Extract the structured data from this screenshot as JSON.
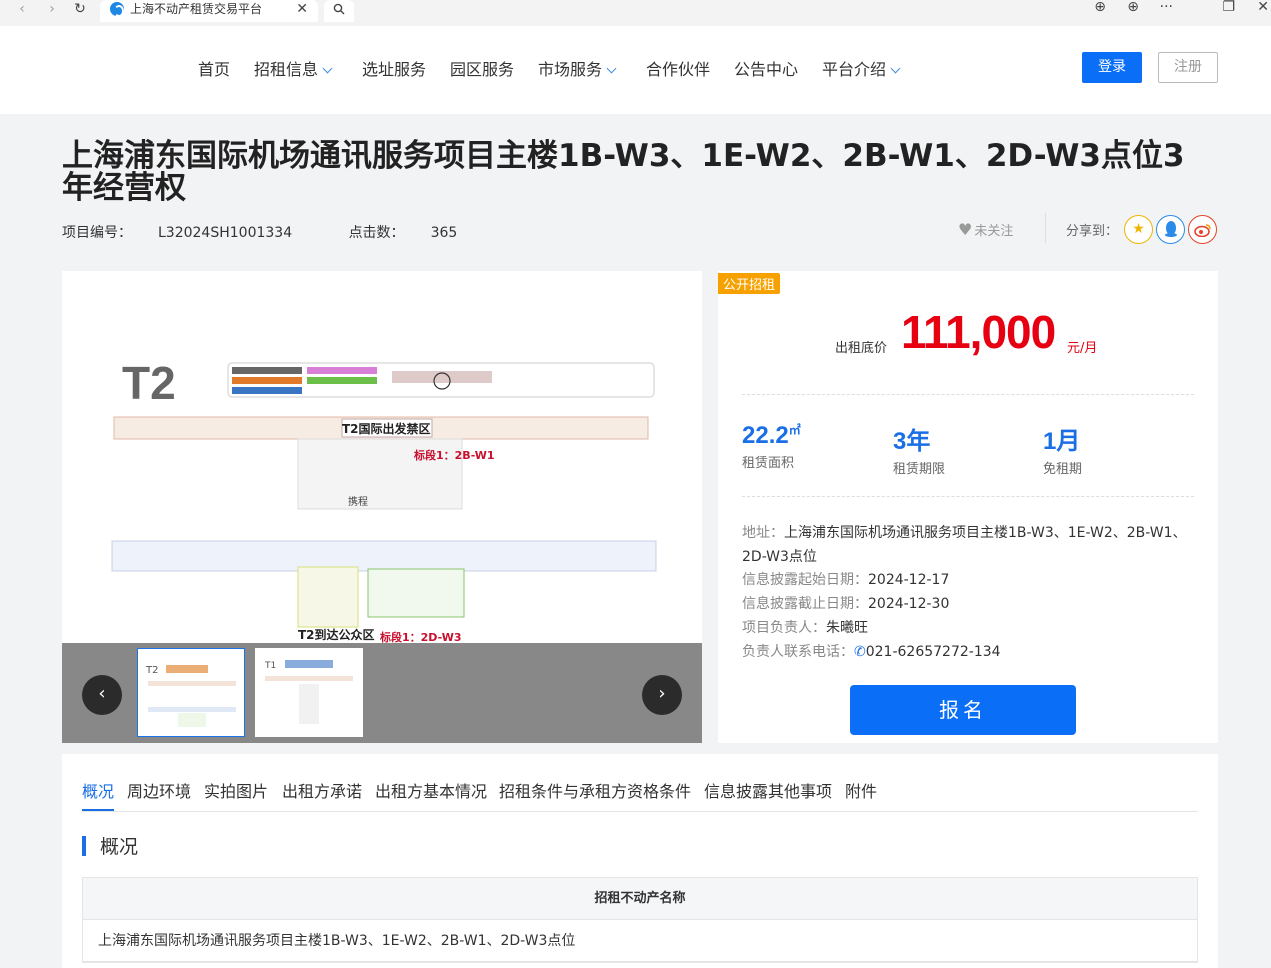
{
  "browser": {
    "tab_title": "上海不动产租赁交易平台"
  },
  "header": {
    "nav": [
      {
        "label": "首页",
        "dropdown": false
      },
      {
        "label": "招租信息",
        "dropdown": true
      },
      {
        "label": "选址服务",
        "dropdown": false
      },
      {
        "label": "园区服务",
        "dropdown": false
      },
      {
        "label": "市场服务",
        "dropdown": true
      },
      {
        "label": "合作伙伴",
        "dropdown": false
      },
      {
        "label": "公告中心",
        "dropdown": false
      },
      {
        "label": "平台介绍",
        "dropdown": true
      }
    ],
    "login_label": "登录",
    "register_label": "注册"
  },
  "project": {
    "title": "上海浦东国际机场通讯服务项目主楼1B-W3、1E-W2、2B-W1、2D-W3点位3年经营权",
    "code_label": "项目编号：",
    "code": "L32024SH1001334",
    "clicks_label": "点击数：",
    "clicks": "365",
    "follow_label": "未关注",
    "share_label": "分享到："
  },
  "gallery": {
    "map_labels": {
      "terminal": "T2",
      "departure": "T2国际出发禁区",
      "arrival": "T2到达公众区",
      "lot1_w1": "标段1：2B-W1",
      "lot1_w3": "标段1：2D-W3",
      "ctrip": "携程"
    },
    "thumb_labels": [
      "T2",
      "T1"
    ]
  },
  "panel": {
    "badge": "公开招租",
    "price_label": "出租底价",
    "price": "111,000",
    "price_unit": "元/月",
    "stats": [
      {
        "value": "22.2",
        "unit": "㎡",
        "label": "租赁面积"
      },
      {
        "value": "3年",
        "unit": "",
        "label": "租赁期限"
      },
      {
        "value": "1月",
        "unit": "",
        "label": "免租期"
      }
    ],
    "address_label": "地址：",
    "address": "上海浦东国际机场通讯服务项目主楼1B-W3、1E-W2、2B-W1、2D-W3点位",
    "start_label": "信息披露起始日期：",
    "start_date": "2024-12-17",
    "end_label": "信息披露截止日期：",
    "end_date": "2024-12-30",
    "manager_label": "项目负责人：",
    "manager": "朱曦旺",
    "phone_label": "负责人联系电话：",
    "phone": "021-62657272-134",
    "apply_label": "报名"
  },
  "content": {
    "tabs": [
      "概况",
      "周边环境",
      "实拍图片",
      "出租方承诺",
      "出租方基本情况",
      "招租条件与承租方资格条件",
      "信息披露其他事项",
      "附件"
    ],
    "active_tab": 0,
    "section_title": "概况",
    "table_header": "招租不动产名称",
    "table_value": "上海浦东国际机场通讯服务项目主楼1B-W3、1E-W2、2B-W1、2D-W3点位"
  },
  "colors": {
    "primary": "#0a6ef7",
    "price": "#e60012",
    "badge": "#f6a100",
    "stat": "#1a6ee6"
  }
}
